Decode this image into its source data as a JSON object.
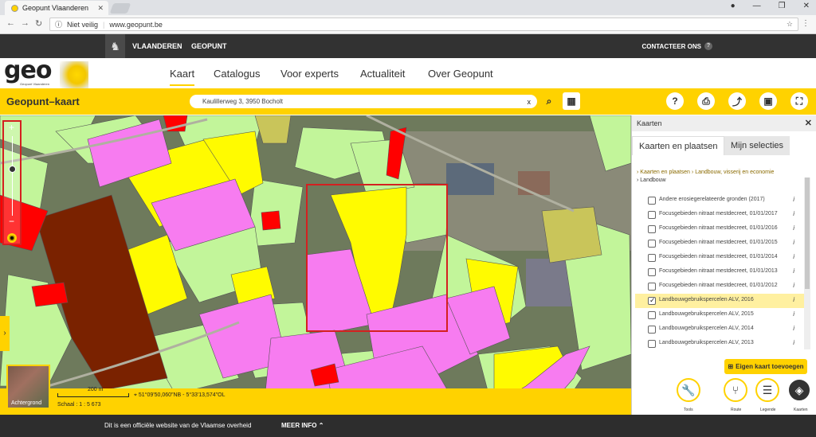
{
  "browser": {
    "tab_title": "Geopunt Vlaanderen",
    "security": "Niet veilig",
    "url": "www.geopunt.be"
  },
  "topbar": {
    "vlaanderen": "VLAANDEREN",
    "geopunt": "GEOPUNT",
    "contact": "CONTACTEER ONS",
    "contact_help": "?"
  },
  "logo": {
    "text": "geo",
    "sub": "Geopunt Vlaanderen"
  },
  "nav": {
    "items": [
      "Kaart",
      "Catalogus",
      "Voor experts",
      "Actualiteit",
      "Over Geopunt"
    ],
    "active": "Kaart"
  },
  "toolbar": {
    "title": "Geopunt–kaart",
    "search_value": "Kaulillerweg 3, 3950 Bocholt",
    "clear": "x",
    "help": "?"
  },
  "map": {
    "background_label": "Achtergrond",
    "scale_bar": "200 m",
    "coordinates": "51°09'50,060\"NB - 5°33'13,574\"OL",
    "scale": "Schaal : 1 : 5 673",
    "colors": {
      "light_green": "#c2f59a",
      "yellow": "#fffb00",
      "magenta": "#f77cf0",
      "brown": "#7a2200",
      "red": "#ff0000",
      "olive": "#c9c55a",
      "highlight": "#d42020"
    }
  },
  "panel": {
    "title": "Kaarten",
    "tabs": [
      "Kaarten en plaatsen",
      "Mijn selecties"
    ],
    "breadcrumb": [
      "Kaarten en plaatsen",
      "Landbouw, visserij en economie",
      "Landbouw"
    ],
    "layers": [
      {
        "label": "Andere erosiegerelateerde gronden (2017)",
        "checked": false
      },
      {
        "label": "Focusgebieden nitraat mestdecreet, 01/01/2017",
        "checked": false
      },
      {
        "label": "Focusgebieden nitraat mestdecreet, 01/01/2016",
        "checked": false
      },
      {
        "label": "Focusgebieden nitraat mestdecreet, 01/01/2015",
        "checked": false
      },
      {
        "label": "Focusgebieden nitraat mestdecreet, 01/01/2014",
        "checked": false
      },
      {
        "label": "Focusgebieden nitraat mestdecreet, 01/01/2013",
        "checked": false
      },
      {
        "label": "Focusgebieden nitraat mestdecreet, 01/01/2012",
        "checked": false
      },
      {
        "label": "Landbouwgebruikspercelen ALV, 2016",
        "checked": true
      },
      {
        "label": "Landbouwgebruikspercelen ALV, 2015",
        "checked": false
      },
      {
        "label": "Landbouwgebruikspercelen ALV, 2014",
        "checked": false
      },
      {
        "label": "Landbouwgebruikspercelen ALV, 2013",
        "checked": false
      }
    ],
    "info": "i",
    "add_button": "Eigen kaart toevoegen"
  },
  "tools": [
    "Tools",
    "Route",
    "Legende",
    "Kaarten"
  ],
  "footer": {
    "text": "Dit is een officiële website van de Vlaamse overheid",
    "more": "MEER INFO"
  }
}
